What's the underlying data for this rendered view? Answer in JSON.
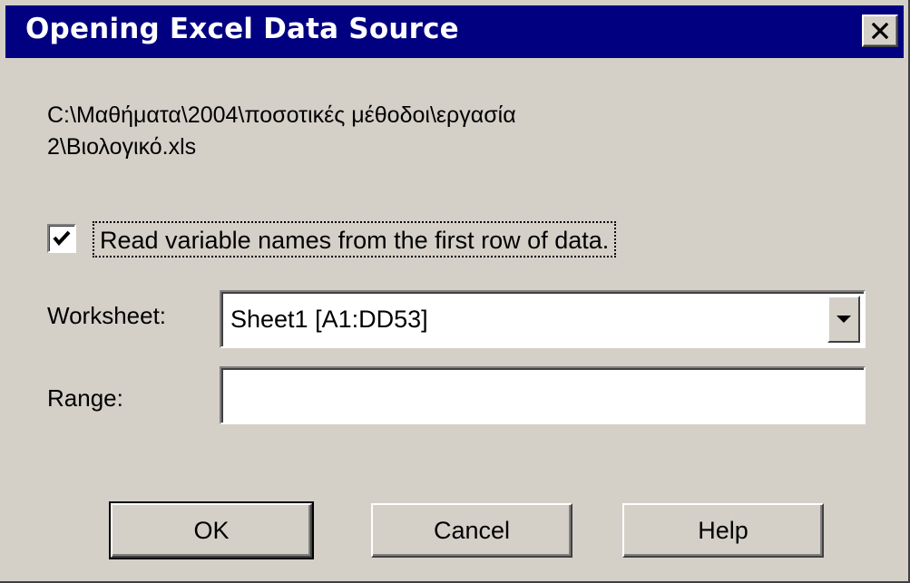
{
  "window": {
    "title": "Opening Excel Data Source",
    "close_icon": "close-icon"
  },
  "file_path": {
    "line1": "C:\\Μαθήματα\\2004\\ποσοτικές μέθοδοι\\εργασία",
    "line2": "2\\Βιολογικό.xls"
  },
  "read_names": {
    "label": "Read variable names from the first row of data.",
    "checked": true
  },
  "worksheet": {
    "label": "Worksheet:",
    "value": "Sheet1  [A1:DD53]",
    "dropdown_icon": "chevron-down-icon"
  },
  "range": {
    "label": "Range:",
    "value": ""
  },
  "buttons": {
    "ok": "OK",
    "cancel": "Cancel",
    "help": "Help"
  }
}
